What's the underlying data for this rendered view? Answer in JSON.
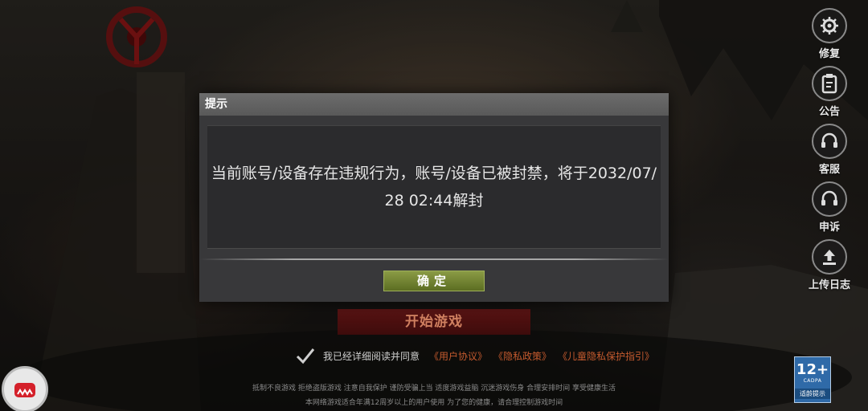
{
  "side_menu": [
    {
      "label": "修复",
      "icon": "gear-icon"
    },
    {
      "label": "公告",
      "icon": "clipboard-icon"
    },
    {
      "label": "客服",
      "icon": "headset-icon"
    },
    {
      "label": "申诉",
      "icon": "headset-icon"
    },
    {
      "label": "上传日志",
      "icon": "upload-icon"
    }
  ],
  "start_button": "开始游戏",
  "agreement": {
    "text": "我已经详细阅读并同意",
    "links": [
      "《用户协议》",
      "《隐私政策》",
      "《儿童隐私保护指引》"
    ]
  },
  "footer": {
    "line1": "抵制不良游戏  拒绝盗版游戏  注意自我保护  谨防受骗上当  适度游戏益脑  沉迷游戏伤身  合理安排时间  享受健康生活",
    "line2": "本网络游戏适合年满12周岁以上的用户使用    为了您的健康，请合理控制游戏时间"
  },
  "age_rating": {
    "number": "12+",
    "org": "CADPA",
    "tip": "适龄提示"
  },
  "dialog": {
    "title": "提示",
    "message": "当前账号/设备存在违规行为，账号/设备已被封禁，将于2032/07/28 02:44解封",
    "confirm_label": "确定"
  },
  "colors": {
    "dialog_header": "#595959",
    "confirm_button": "#6f8030",
    "start_button": "#4a1010",
    "link": "#c45a2e"
  }
}
